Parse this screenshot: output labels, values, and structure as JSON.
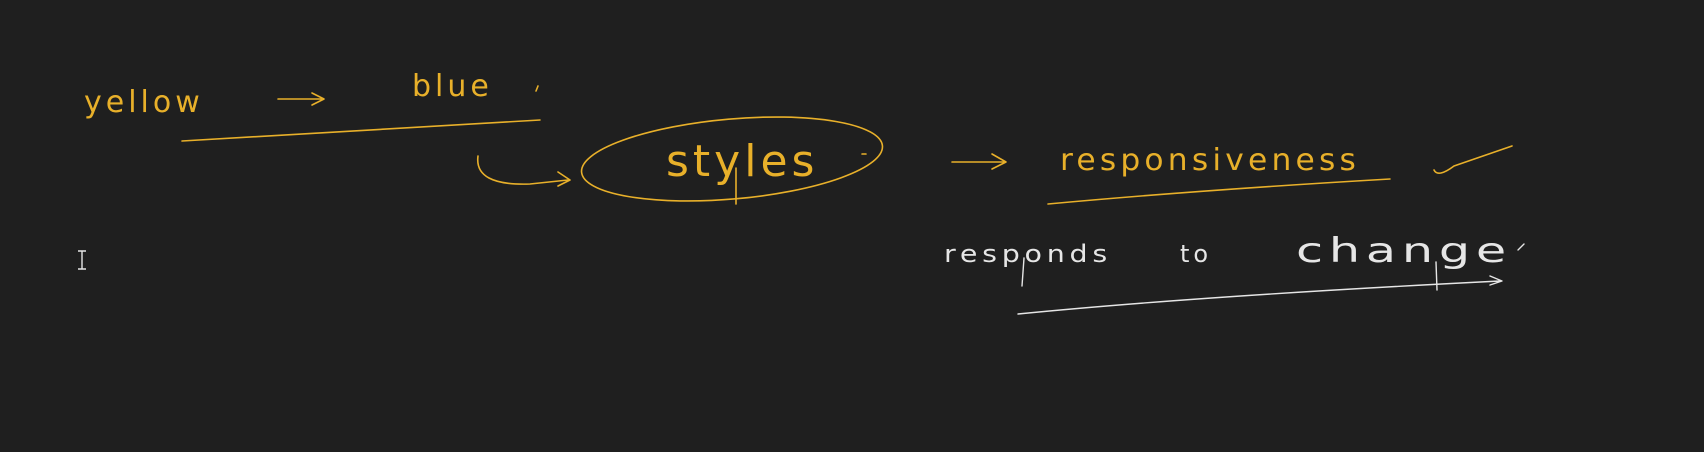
{
  "handwriting": {
    "yellow_word": "yellow",
    "blue_word": "blue",
    "styles_word": "styles",
    "responsiveness_word": "responsiveness",
    "responds_word": "responds",
    "to_word": "to",
    "change_word": "change"
  },
  "colors": {
    "background": "#1f1f1f",
    "yellow_ink": "#e8b02a",
    "white_ink": "#e6e6e6"
  },
  "cursor": {
    "icon": "text-cursor-icon"
  }
}
